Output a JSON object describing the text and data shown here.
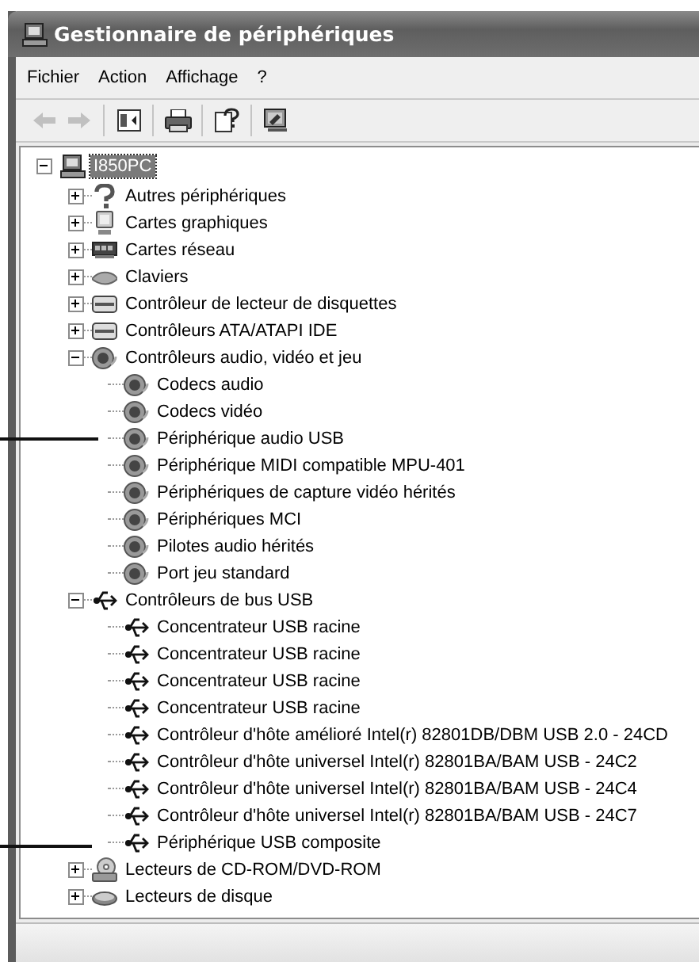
{
  "window": {
    "title": "Gestionnaire de périphériques"
  },
  "menu": [
    "Fichier",
    "Action",
    "Affichage",
    "?"
  ],
  "toolbar": [
    [
      {
        "kind": "back",
        "disabled": true
      },
      {
        "kind": "forward",
        "disabled": true
      }
    ],
    [
      {
        "kind": "tree",
        "disabled": false
      }
    ],
    [
      {
        "kind": "print",
        "disabled": false
      }
    ],
    [
      {
        "kind": "properties",
        "disabled": false
      }
    ],
    [
      {
        "kind": "scan",
        "disabled": false
      }
    ]
  ],
  "tree": {
    "label": "I850PC",
    "kind": "computer",
    "expanded": true,
    "selected": true,
    "children": [
      {
        "label": "Autres périphériques",
        "kind": "unknown",
        "expanded": false,
        "selected": false
      },
      {
        "label": "Cartes graphiques",
        "kind": "display",
        "expanded": false,
        "selected": false
      },
      {
        "label": "Cartes réseau",
        "kind": "network",
        "expanded": false,
        "selected": false
      },
      {
        "label": "Claviers",
        "kind": "keyboard",
        "expanded": false,
        "selected": false
      },
      {
        "label": "Contrôleur de lecteur de disquettes",
        "kind": "drive",
        "expanded": false,
        "selected": false
      },
      {
        "label": "Contrôleurs ATA/ATAPI IDE",
        "kind": "drive",
        "expanded": false,
        "selected": false
      },
      {
        "label": "Contrôleurs audio, vidéo et jeu",
        "kind": "sound",
        "expanded": true,
        "selected": false,
        "children": [
          {
            "label": "Codecs audio",
            "kind": "sound",
            "selected": false
          },
          {
            "label": "Codecs vidéo",
            "kind": "sound",
            "selected": false
          },
          {
            "label": "Périphérique audio USB",
            "kind": "sound",
            "selected": false
          },
          {
            "label": "Périphérique MIDI compatible MPU-401",
            "kind": "sound",
            "selected": false
          },
          {
            "label": "Périphériques de capture vidéo hérités",
            "kind": "sound",
            "selected": false
          },
          {
            "label": "Périphériques MCI",
            "kind": "sound",
            "selected": false
          },
          {
            "label": "Pilotes audio hérités",
            "kind": "sound",
            "selected": false
          },
          {
            "label": "Port jeu standard",
            "kind": "sound",
            "selected": false
          }
        ]
      },
      {
        "label": "Contrôleurs de bus USB",
        "kind": "usb",
        "expanded": true,
        "selected": false,
        "children": [
          {
            "label": "Concentrateur USB racine",
            "kind": "usb",
            "selected": false
          },
          {
            "label": "Concentrateur USB racine",
            "kind": "usb",
            "selected": false
          },
          {
            "label": "Concentrateur USB racine",
            "kind": "usb",
            "selected": false
          },
          {
            "label": "Concentrateur USB racine",
            "kind": "usb",
            "selected": false
          },
          {
            "label": "Contrôleur d'hôte amélioré Intel(r) 82801DB/DBM USB 2.0 - 24CD",
            "kind": "usb",
            "selected": false
          },
          {
            "label": "Contrôleur d'hôte universel Intel(r) 82801BA/BAM USB - 24C2",
            "kind": "usb",
            "selected": false
          },
          {
            "label": "Contrôleur d'hôte universel Intel(r) 82801BA/BAM USB - 24C4",
            "kind": "usb",
            "selected": false
          },
          {
            "label": "Contrôleur d'hôte universel Intel(r) 82801BA/BAM USB - 24C7",
            "kind": "usb",
            "selected": false
          },
          {
            "label": "Périphérique USB composite",
            "kind": "usb",
            "selected": false
          }
        ]
      },
      {
        "label": "Lecteurs de CD-ROM/DVD-ROM",
        "kind": "cdrom",
        "expanded": false,
        "selected": false
      },
      {
        "label": "Lecteurs de disque",
        "kind": "disk",
        "expanded": false,
        "selected": false
      }
    ]
  }
}
